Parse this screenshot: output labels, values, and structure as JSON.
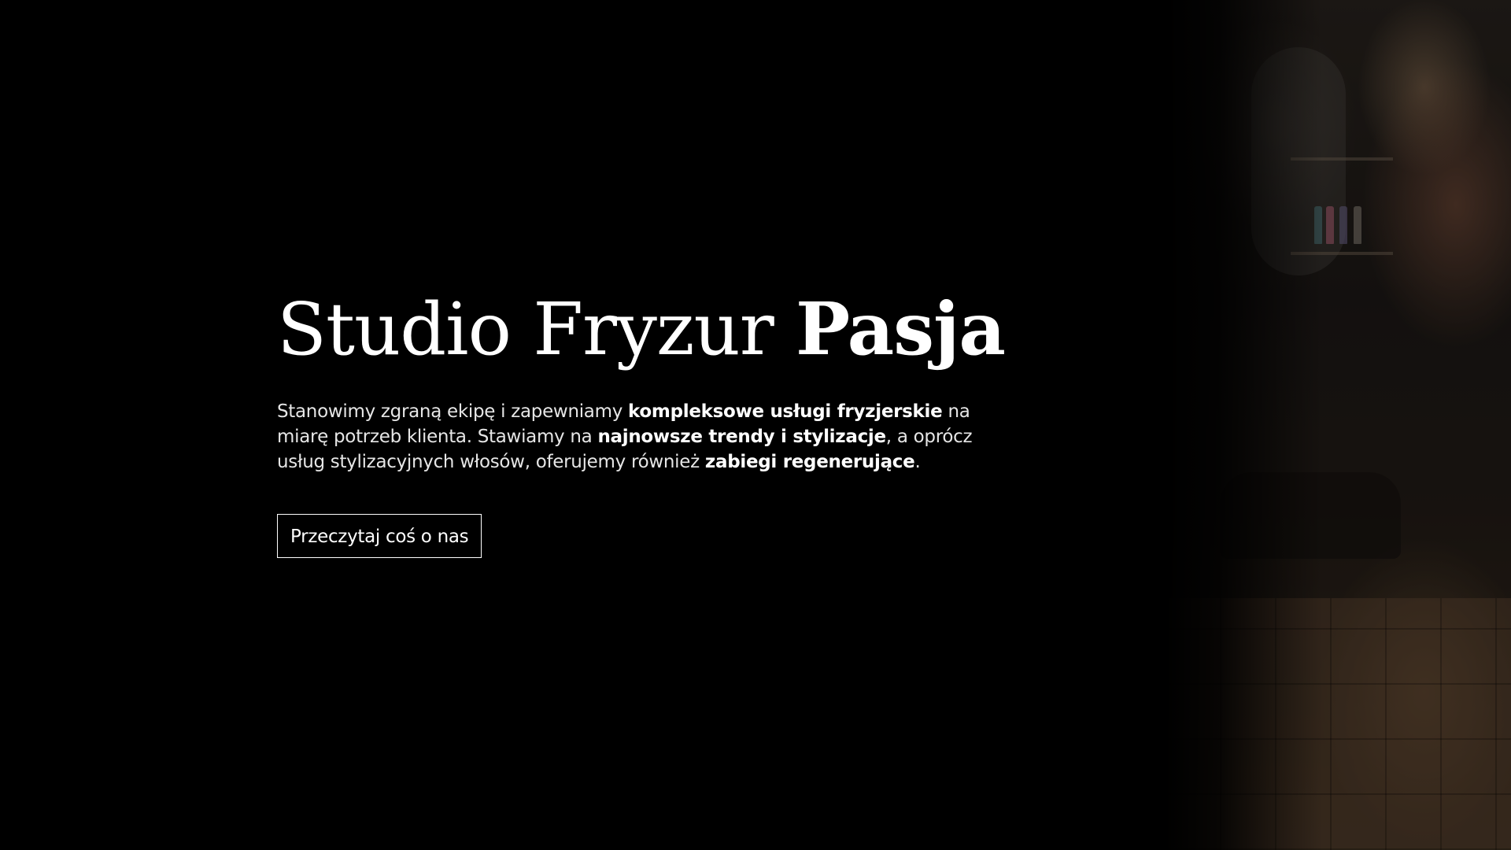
{
  "hero": {
    "title_regular": "Studio Fryzur",
    "title_bold": "Pasja",
    "description": {
      "part1": "Stanowimy zgraną ekipę i zapewniamy ",
      "bold1": "kompleksowe usługi fryzjerskie",
      "part2": " na miarę potrzeb klienta. Stawiamy na ",
      "bold2": "najnowsze trendy i stylizacje",
      "part3": ", a oprócz usług stylizacyjnych włosów, oferujemy również ",
      "bold3": "zabiegi regenerujące",
      "part4": "."
    },
    "cta_label": "Przeczytaj coś o nas"
  },
  "colors": {
    "background": "#000000",
    "text": "#ffffff",
    "button_border": "#ffffff"
  }
}
